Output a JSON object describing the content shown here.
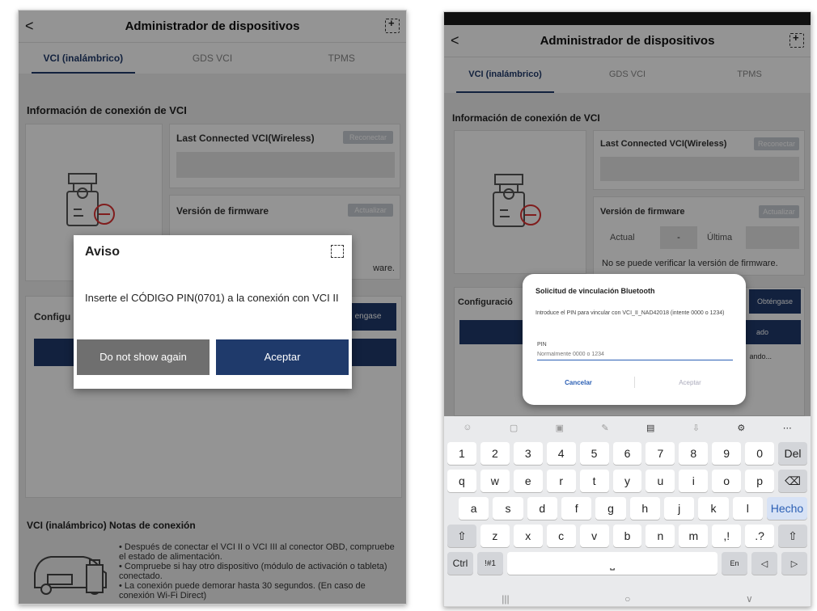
{
  "left": {
    "appbar": {
      "back": "<",
      "title": "Administrador de dispositivos"
    },
    "tabs": [
      "VCI (inalámbrico)",
      "GDS VCI",
      "TPMS"
    ],
    "section_title": "Información de conexión de VCI",
    "last_connected": {
      "title": "Last Connected VCI(Wireless)",
      "button": "Reconectar"
    },
    "firmware": {
      "title": "Versión de firmware",
      "button": "Actualizar",
      "note_tail": "ware."
    },
    "config": {
      "label": "Configu",
      "button": "engase"
    },
    "dialog": {
      "title": "Aviso",
      "message": "Inserte el CÓDIGO PIN(0701) a la conexión con VCI II",
      "btn_secondary": "Do not show again",
      "btn_primary": "Aceptar"
    },
    "notes_title": "VCI (inalámbrico) Notas de conexión",
    "notes": [
      "• Después de conectar el VCI II o VCI III al conector OBD, compruebe el estado de alimentación.",
      "• Compruebe si hay otro dispositivo (módulo de activación o tableta) conectado.",
      "• La conexión puede demorar hasta 30 segundos. (En caso de conexión Wi-Fi Direct)"
    ]
  },
  "right": {
    "appbar": {
      "back": "<",
      "title": "Administrador de dispositivos"
    },
    "tabs": [
      "VCI (inalámbrico)",
      "GDS VCI",
      "TPMS"
    ],
    "section_title": "Información de conexión de VCI",
    "last_connected": {
      "title": "Last Connected VCI(Wireless)",
      "button": "Reconectar"
    },
    "firmware": {
      "title": "Versión de firmware",
      "button": "Actualizar",
      "actual_label": "Actual",
      "actual_value": "-",
      "latest_label": "Última",
      "note": "No se puede verificar la versión de firmware."
    },
    "config": {
      "label": "Configuració",
      "button": "Obténgase",
      "bar_text": "ado",
      "row_text": "ando..."
    },
    "dialog": {
      "title": "Solicitud de vinculación Bluetooth",
      "message": "Introduce el PIN para vincular con VCI_II_NAD42018 (intente 0000 o 1234)",
      "pin_label": "PIN",
      "pin_placeholder": "Normalmente 0000 o 1234",
      "cancel": "Cancelar",
      "accept": "Aceptar"
    },
    "keyboard": {
      "row_numbers": [
        "1",
        "2",
        "3",
        "4",
        "5",
        "6",
        "7",
        "8",
        "9",
        "0",
        "Del"
      ],
      "row_q": [
        "q",
        "w",
        "e",
        "r",
        "t",
        "y",
        "u",
        "i",
        "o",
        "p",
        "⌫"
      ],
      "row_a": [
        "a",
        "s",
        "d",
        "f",
        "g",
        "h",
        "j",
        "k",
        "l",
        "Hecho"
      ],
      "row_z": [
        "⇧",
        "z",
        "x",
        "c",
        "v",
        "b",
        "n",
        "m",
        ",!",
        ".?",
        "⇧"
      ],
      "row_bottom": {
        "ctrl": "Ctrl",
        "sym": "!#1",
        "space": "⎵",
        "lang": "En",
        "left": "◁",
        "right": "▷"
      }
    },
    "navbar": [
      "|||",
      "○",
      "∨"
    ]
  },
  "colors": {
    "primary": "#1f3a6b",
    "secondary_btn": "#6f6f6f",
    "accent_blue": "#2b5fb4"
  }
}
